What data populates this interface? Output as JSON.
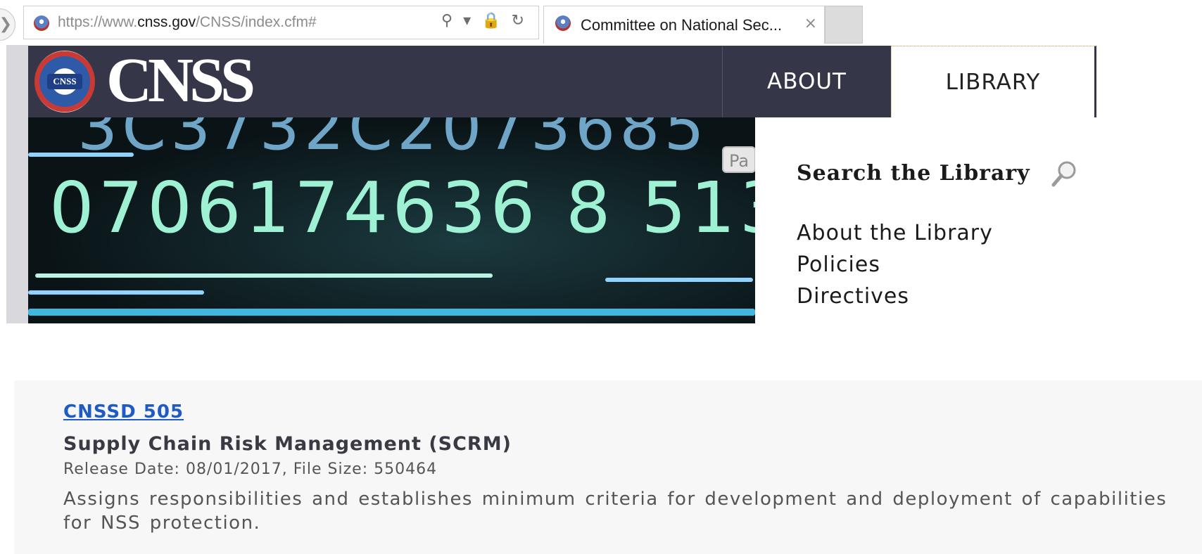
{
  "browser": {
    "url_prefix": "https://www.",
    "url_host": "cnss.gov",
    "url_path": "/CNSS/index.cfm#",
    "address_icons": "⚲ ▾ 🔒 ↻",
    "tab_title": "Committee on National Sec...",
    "tab_close": "×",
    "back_glyph": "❯"
  },
  "site": {
    "logo_text": "CNSS",
    "seal_text": "CNSS",
    "nav": {
      "about": "ABOUT",
      "library": "LIBRARY"
    },
    "hero": {
      "line1": "3C3732C2073685",
      "line2": "0706174636 8 513",
      "tag": "Pa"
    }
  },
  "dropdown": {
    "title": "Search the Library",
    "links": [
      "About the Library",
      "Policies",
      "Directives"
    ]
  },
  "document": {
    "id": "CNSSD 505",
    "title": "Supply Chain Risk Management (SCRM)",
    "meta": "Release Date: 08/01/2017, File Size: 550464",
    "description": "Assigns responsibilities and establishes minimum criteria for development and deployment of capabilities for NSS protection."
  },
  "colors": {
    "header_bg": "#363649",
    "link_blue": "#1f5bc5",
    "card_bg": "#f7f7f8"
  },
  "icons": [
    "back-arrow-icon",
    "site-globe-icon",
    "search-icon",
    "lock-icon",
    "refresh-icon",
    "tab-close-icon",
    "cnss-seal-icon",
    "magnifier-icon"
  ]
}
